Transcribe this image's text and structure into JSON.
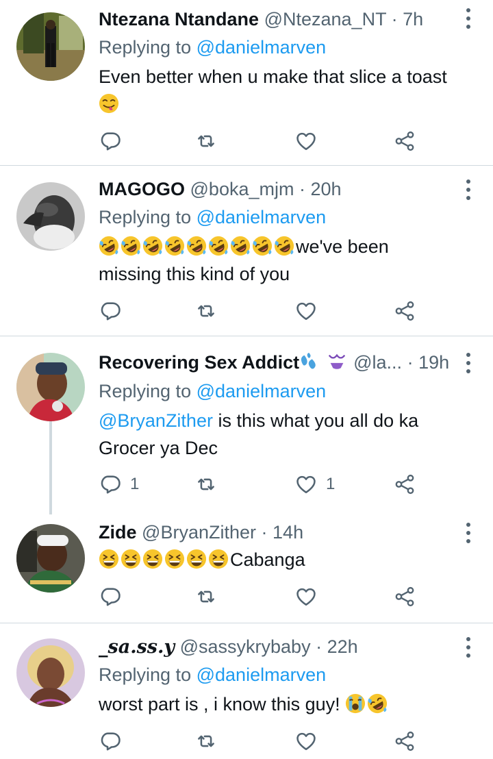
{
  "tweets": [
    {
      "name": "Ntezana Ntandane",
      "handle": "@Ntezana_NT",
      "sep": "·",
      "time": "7h",
      "replying_prefix": "Replying to",
      "replying_to": "@danielmarven",
      "text_line1": "Even better when u make that slice a toast",
      "emoji_names": [
        "face-savoring-food-emoji"
      ],
      "reply_count": "",
      "like_count": ""
    },
    {
      "name": "MAGOGO",
      "handle": "@boka_mjm",
      "sep": "·",
      "time": "20h",
      "replying_prefix": "Replying to",
      "replying_to": "@danielmarven",
      "text_after_emoji": "we've been",
      "text_line2": "missing this kind of you",
      "emoji_names": [
        "rofl-emoji",
        "rofl-emoji",
        "rofl-emoji",
        "rofl-emoji",
        "rofl-emoji",
        "rofl-emoji",
        "rofl-emoji",
        "rofl-emoji",
        "rofl-emoji"
      ],
      "reply_count": "",
      "like_count": ""
    },
    {
      "name": "Recovering Sex Addict",
      "handle": "@la...",
      "sep": "·",
      "time": "19h",
      "replying_prefix": "Replying to",
      "replying_to": "@danielmarven",
      "mention": "@BryanZither",
      "text_line1": " is this what you all do ka",
      "text_line2": "Grocer ya Dec",
      "name_emoji_names": [
        "sweat-droplets-emoji",
        "bikini-emoji"
      ],
      "reply_count": "1",
      "like_count": "1"
    },
    {
      "name": "Zide",
      "handle": "@BryanZither",
      "sep": "·",
      "time": "14h",
      "text_after_emoji": "Cabanga",
      "emoji_names": [
        "grinning-squinting-face-emoji",
        "grinning-squinting-face-emoji",
        "grinning-squinting-face-emoji",
        "grinning-squinting-face-emoji",
        "grinning-squinting-face-emoji",
        "grinning-squinting-face-emoji"
      ],
      "reply_count": "",
      "like_count": ""
    },
    {
      "name": "_sa.ss.y",
      "handle": "@sassykrybaby",
      "sep": "·",
      "time": "22h",
      "replying_prefix": "Replying to",
      "replying_to": "@danielmarven",
      "text_line1": "worst part is , i know this guy! ",
      "emoji_names": [
        "loudly-crying-face-emoji",
        "rofl-emoji"
      ],
      "reply_count": "",
      "like_count": ""
    }
  ],
  "colors": {
    "link": "#1d9bf0",
    "secondary_text": "#536471",
    "divider": "#cfd9de",
    "primary_text": "#0f1419"
  },
  "icons": [
    "reply-icon",
    "retweet-icon",
    "like-icon",
    "share-icon",
    "more-options-icon"
  ]
}
